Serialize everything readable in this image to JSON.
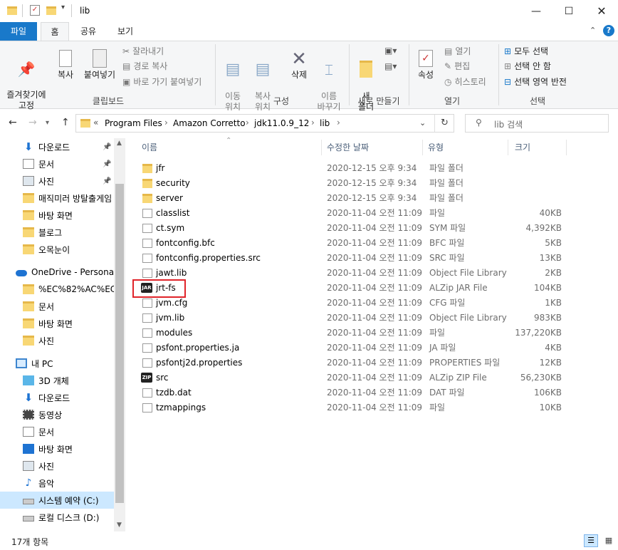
{
  "window": {
    "title": "lib"
  },
  "ribbon_tabs": [
    "파일",
    "홈",
    "공유",
    "보기"
  ],
  "ribbon": {
    "clipboard": {
      "pin": "즐겨찾기에\n고정",
      "copy": "복사",
      "paste": "붙여넣기",
      "cut": "잘라내기",
      "copy_path": "경로 복사",
      "paste_shortcut": "바로 가기 붙여넣기",
      "label": "클립보드"
    },
    "organize": {
      "move": "이동\n위치",
      "copy_to": "복사\n위치",
      "delete": "삭제",
      "rename": "이름\n바꾸기",
      "label": "구성"
    },
    "new": {
      "new_folder": "새\n폴더",
      "label": "새로 만들기"
    },
    "open": {
      "properties": "속성",
      "open": "열기",
      "edit": "편집",
      "history": "히스토리",
      "label": "열기"
    },
    "select": {
      "select_all": "모두 선택",
      "select_none": "선택 안 함",
      "invert": "선택 영역 반전",
      "label": "선택"
    }
  },
  "address": {
    "breadcrumbs": [
      "Program Files",
      "Amazon Corretto",
      "jdk11.0.9_12",
      "lib"
    ],
    "search_placeholder": "lib 검색"
  },
  "sidebar": [
    {
      "label": "다운로드",
      "icon": "download-icon",
      "pinned": true
    },
    {
      "label": "문서",
      "icon": "document-icon",
      "pinned": true
    },
    {
      "label": "사진",
      "icon": "picture-icon",
      "pinned": true
    },
    {
      "label": "매직미러 방탈출게임",
      "icon": "folder-icon"
    },
    {
      "label": "바탕 화면",
      "icon": "folder-icon"
    },
    {
      "label": "블로그",
      "icon": "folder-icon"
    },
    {
      "label": "오목눈이",
      "icon": "folder-icon"
    },
    {
      "label": "OneDrive - Personal",
      "icon": "cloud-icon"
    },
    {
      "label": "%EC%82%AC%EC%",
      "icon": "folder-icon"
    },
    {
      "label": "문서",
      "icon": "folder-icon"
    },
    {
      "label": "바탕 화면",
      "icon": "folder-icon"
    },
    {
      "label": "사진",
      "icon": "folder-icon"
    },
    {
      "label": "내 PC",
      "icon": "pc-icon"
    },
    {
      "label": "3D 개체",
      "icon": "cube-icon"
    },
    {
      "label": "다운로드",
      "icon": "download-icon"
    },
    {
      "label": "동영상",
      "icon": "video-icon"
    },
    {
      "label": "문서",
      "icon": "document-icon"
    },
    {
      "label": "바탕 화면",
      "icon": "desktop-icon"
    },
    {
      "label": "사진",
      "icon": "picture-icon"
    },
    {
      "label": "음악",
      "icon": "music-icon"
    },
    {
      "label": "시스템 예약 (C:)",
      "icon": "drive-icon",
      "selected": true
    },
    {
      "label": "로컬 디스크 (D:)",
      "icon": "drive-icon"
    }
  ],
  "columns": {
    "name": "이름",
    "date": "수정한 날짜",
    "type": "유형",
    "size": "크기"
  },
  "files": [
    {
      "name": "jfr",
      "date": "2020-12-15 오후 9:34",
      "type": "파일 폴더",
      "size": "",
      "icon": "folder-icon"
    },
    {
      "name": "security",
      "date": "2020-12-15 오후 9:34",
      "type": "파일 폴더",
      "size": "",
      "icon": "folder-icon"
    },
    {
      "name": "server",
      "date": "2020-12-15 오후 9:34",
      "type": "파일 폴더",
      "size": "",
      "icon": "folder-icon"
    },
    {
      "name": "classlist",
      "date": "2020-11-04 오전 11:09",
      "type": "파일",
      "size": "40KB",
      "icon": "file-icon"
    },
    {
      "name": "ct.sym",
      "date": "2020-11-04 오전 11:09",
      "type": "SYM 파일",
      "size": "4,392KB",
      "icon": "file-icon"
    },
    {
      "name": "fontconfig.bfc",
      "date": "2020-11-04 오전 11:09",
      "type": "BFC 파일",
      "size": "5KB",
      "icon": "file-icon"
    },
    {
      "name": "fontconfig.properties.src",
      "date": "2020-11-04 오전 11:09",
      "type": "SRC 파일",
      "size": "13KB",
      "icon": "file-icon"
    },
    {
      "name": "jawt.lib",
      "date": "2020-11-04 오전 11:09",
      "type": "Object File Library",
      "size": "2KB",
      "icon": "file-icon"
    },
    {
      "name": "jrt-fs",
      "date": "2020-11-04 오전 11:09",
      "type": "ALZip JAR File",
      "size": "104KB",
      "icon": "jar-icon"
    },
    {
      "name": "jvm.cfg",
      "date": "2020-11-04 오전 11:09",
      "type": "CFG 파일",
      "size": "1KB",
      "icon": "file-icon"
    },
    {
      "name": "jvm.lib",
      "date": "2020-11-04 오전 11:09",
      "type": "Object File Library",
      "size": "983KB",
      "icon": "file-icon"
    },
    {
      "name": "modules",
      "date": "2020-11-04 오전 11:09",
      "type": "파일",
      "size": "137,220KB",
      "icon": "file-icon"
    },
    {
      "name": "psfont.properties.ja",
      "date": "2020-11-04 오전 11:09",
      "type": "JA 파일",
      "size": "4KB",
      "icon": "file-icon"
    },
    {
      "name": "psfontj2d.properties",
      "date": "2020-11-04 오전 11:09",
      "type": "PROPERTIES 파일",
      "size": "12KB",
      "icon": "file-icon"
    },
    {
      "name": "src",
      "date": "2020-11-04 오전 11:09",
      "type": "ALZip ZIP File",
      "size": "56,230KB",
      "icon": "zip-icon"
    },
    {
      "name": "tzdb.dat",
      "date": "2020-11-04 오전 11:09",
      "type": "DAT 파일",
      "size": "106KB",
      "icon": "file-icon"
    },
    {
      "name": "tzmappings",
      "date": "2020-11-04 오전 11:09",
      "type": "파일",
      "size": "10KB",
      "icon": "file-icon"
    }
  ],
  "status": {
    "count": "17개 항목"
  },
  "colors": {
    "accent": "#1979ca",
    "highlight": "#e0242a",
    "folder": "#f8d775",
    "selected": "#cce8ff"
  }
}
